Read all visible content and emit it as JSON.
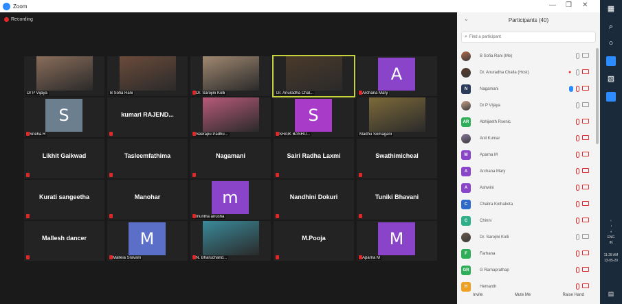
{
  "window": {
    "title": "Zoom"
  },
  "recording": {
    "label": "Recording"
  },
  "tiles": [
    {
      "name": "Dr P Vijaya",
      "kind": "photo",
      "color": "#8a6d5a",
      "mic_off": false
    },
    {
      "name": "B Sofia Rani",
      "kind": "photo",
      "color": "#6b4b3a",
      "mic_off": false
    },
    {
      "name": "Dr. Sarojini Kolli",
      "kind": "photo",
      "color": "#a08870",
      "mic_off": true
    },
    {
      "name": "Dr. Anuradha Chal...",
      "kind": "photo",
      "color": "#4b3a2a",
      "mic_off": false,
      "active": true
    },
    {
      "name": "Archana Mary",
      "kind": "avatar",
      "letter": "A",
      "color": "#8a44c9",
      "mic_off": true
    },
    {
      "name": "Sneha R",
      "kind": "avatar",
      "letter": "S",
      "color": "#6c7f8f",
      "mic_off": true
    },
    {
      "name": "kumari RAJEND...",
      "kind": "text",
      "mic_off": true
    },
    {
      "name": "Seerapu Padhu...",
      "kind": "photo",
      "color": "#b85a7a",
      "mic_off": true
    },
    {
      "name": "SHAIK BASHU...",
      "kind": "avatar",
      "letter": "S",
      "color": "#a83cc9",
      "mic_off": true
    },
    {
      "name": "Madhu Somagani",
      "kind": "photo",
      "color": "#7d6a3a",
      "mic_off": false
    },
    {
      "name": "Likhit Gaikwad",
      "kind": "text",
      "mic_off": true
    },
    {
      "name": "Tasleemfathima",
      "kind": "text",
      "mic_off": true
    },
    {
      "name": "Nagamani",
      "kind": "text",
      "mic_off": true
    },
    {
      "name": "Sairi Radha Laxmi",
      "kind": "text",
      "mic_off": true
    },
    {
      "name": "Swathimicheal",
      "kind": "text",
      "mic_off": true
    },
    {
      "name": "Kurati sangeetha",
      "kind": "text",
      "mic_off": true
    },
    {
      "name": "Manohar",
      "kind": "text",
      "mic_off": true
    },
    {
      "name": "muntha anusha",
      "kind": "avatar",
      "letter": "m",
      "color": "#8a44c9",
      "mic_off": true
    },
    {
      "name": "Nandhini Dokuri",
      "kind": "text",
      "mic_off": true
    },
    {
      "name": "Tuniki Bhavani",
      "kind": "text",
      "mic_off": true
    },
    {
      "name": "Mallesh dancer",
      "kind": "text",
      "mic_off": true
    },
    {
      "name": "Malleia Sravani",
      "kind": "avatar",
      "letter": "M",
      "color": "#5b6fc9",
      "mic_off": true
    },
    {
      "name": "N. Bharuchand...",
      "kind": "photo",
      "color": "#3a8a9a",
      "mic_off": true
    },
    {
      "name": "M.Pooja",
      "kind": "text",
      "mic_off": true
    },
    {
      "name": "Aparna M",
      "kind": "avatar",
      "letter": "M",
      "color": "#8a44c9",
      "mic_off": true
    }
  ],
  "panel": {
    "title": "Participants (40)",
    "search_placeholder": "Find a participant",
    "participants": [
      {
        "name": "B Sofia Rani (Me)",
        "kind": "photo",
        "color": "#b46a4a",
        "mic": "on",
        "cam": "on"
      },
      {
        "name": "Dr. Anuradha Challa (Host)",
        "kind": "photo",
        "color": "#5a3a2a",
        "mic": "on",
        "cam": "off",
        "extra": "heart"
      },
      {
        "name": "Nagamani",
        "kind": "letter",
        "letter": "N",
        "color": "#2a3a5a",
        "mic": "off",
        "cam": "off",
        "extra": "hand"
      },
      {
        "name": "Dr P Vijaya",
        "kind": "photo",
        "color": "#c8a08a",
        "mic": "on",
        "cam": "on"
      },
      {
        "name": "Abhijeeth Rsenic",
        "kind": "letter",
        "letter": "AR",
        "color": "#2fae5a",
        "mic": "off",
        "cam": "off"
      },
      {
        "name": "Anil Kumar",
        "kind": "photo",
        "color": "#8a7aa0",
        "mic": "off",
        "cam": "off"
      },
      {
        "name": "Aparna M",
        "kind": "letter",
        "letter": "M",
        "color": "#8a44c9",
        "mic": "off",
        "cam": "off"
      },
      {
        "name": "Archana Mary",
        "kind": "letter",
        "letter": "A",
        "color": "#8a44c9",
        "mic": "off",
        "cam": "off"
      },
      {
        "name": "Ashwini",
        "kind": "letter",
        "letter": "A",
        "color": "#8a44c9",
        "mic": "off",
        "cam": "off"
      },
      {
        "name": "Chaitra Kothakota",
        "kind": "letter",
        "letter": "C",
        "color": "#2d6ac9",
        "mic": "off",
        "cam": "off"
      },
      {
        "name": "Chinni",
        "kind": "letter",
        "letter": "C",
        "color": "#2fae8a",
        "mic": "off",
        "cam": "off"
      },
      {
        "name": "Dr. Sarojini Kolli",
        "kind": "photo",
        "color": "#6a5a4a",
        "mic": "on",
        "cam": "on"
      },
      {
        "name": "Farhana",
        "kind": "letter",
        "letter": "F",
        "color": "#2fae5a",
        "mic": "off",
        "cam": "off"
      },
      {
        "name": "G Ramaprathap",
        "kind": "letter",
        "letter": "GR",
        "color": "#2fae5a",
        "mic": "off",
        "cam": "off"
      },
      {
        "name": "Hemanth",
        "kind": "letter",
        "letter": "H",
        "color": "#f0a020",
        "mic": "off",
        "cam": "off"
      }
    ],
    "footer": {
      "invite": "Invite",
      "mute_me": "Mute Me",
      "raise_hand": "Raise Hand"
    }
  },
  "taskbar": {
    "lang": "ENG",
    "region": "IN",
    "time": "11:28 AM",
    "date": "13-05-20"
  }
}
